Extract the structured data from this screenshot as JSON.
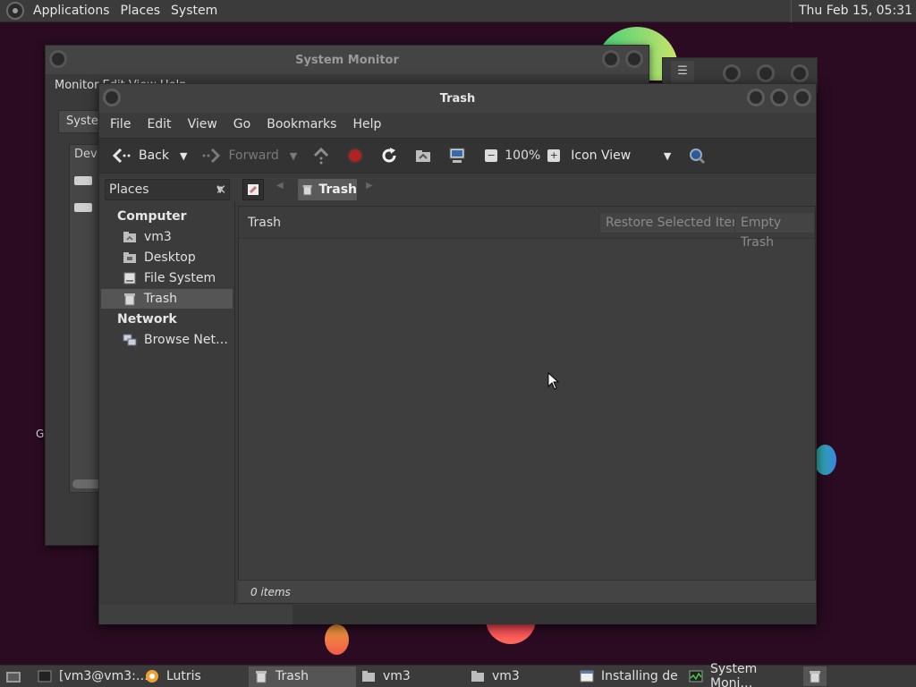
{
  "top_panel": {
    "menus": [
      "Applications",
      "Places",
      "System"
    ],
    "clock": "Thu Feb 15, 05:31"
  },
  "desktop": {
    "left_glyph": "G"
  },
  "system_monitor": {
    "title": "System Monitor",
    "menu_text": "Monitor   Edit   View   Help",
    "tab_label": "System",
    "column_header": "Devi"
  },
  "trash_window": {
    "title": "Trash",
    "menu": [
      "File",
      "Edit",
      "View",
      "Go",
      "Bookmarks",
      "Help"
    ],
    "toolbar": {
      "back": "Back",
      "forward": "Forward",
      "zoom": "100%",
      "view_mode": "Icon View"
    },
    "sidebar_selector": "Places",
    "location_crumb": "Trash",
    "sidebar": {
      "computer_header": "Computer",
      "computer_items": [
        "vm3",
        "Desktop",
        "File System",
        "Trash"
      ],
      "network_header": "Network",
      "network_items": [
        "Browse Net…"
      ]
    },
    "info_bar": {
      "label": "Trash",
      "restore_button": "Restore Selected Items",
      "empty_button": "Empty Trash"
    },
    "status": "0 items"
  },
  "taskbar": {
    "tasks": [
      "[vm3@vm3:…",
      "Lutris",
      "Trash",
      "vm3",
      "vm3",
      "Installing de",
      "System Moni…"
    ]
  }
}
